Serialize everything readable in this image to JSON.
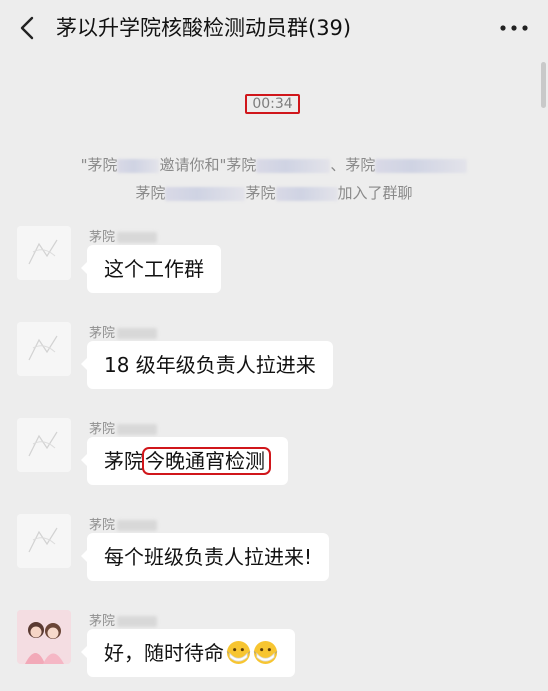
{
  "header": {
    "title": "茅以升学院核酸检测动员群(39)",
    "back_icon": "chevron-left-icon",
    "more_icon": "more-dots-icon"
  },
  "chat": {
    "timestamp": "00:34",
    "system_notice": {
      "line1_a": "\"茅院",
      "line1_b": "邀请你和\"茅院",
      "line1_c": "、茅院",
      "line2_a": "茅院",
      "line2_b": "茅院",
      "line2_c": "加入了群聊"
    },
    "messages": [
      {
        "sender": "茅院",
        "text": "这个工作群"
      },
      {
        "sender": "茅院",
        "text": "18 级年级负责人拉进来"
      },
      {
        "sender": "茅院",
        "text_prefix": "茅院",
        "text_highlight": "今晚通宵检测"
      },
      {
        "sender": "茅院",
        "text": "每个班级负责人拉进来!"
      },
      {
        "sender": "茅院",
        "text": "好，随时待命",
        "emoji": "mask-face-emoji"
      }
    ]
  }
}
